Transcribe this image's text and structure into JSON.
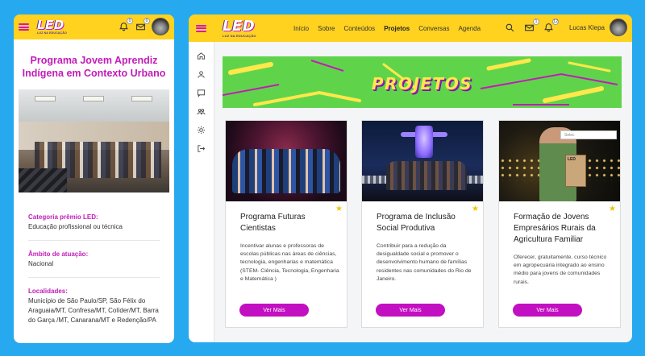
{
  "brand": {
    "logo": "LED",
    "logo_sub": "LUZ NA EDUCAÇÃO"
  },
  "mobile": {
    "badges": {
      "notifications": "0",
      "messages": "0"
    },
    "title": "Programa Jovem Aprendiz Indígena em Contexto Urbano",
    "info": [
      {
        "label": "Categoria prêmio LED:",
        "value": "Educação profissional ou técnica"
      },
      {
        "label": "Âmbito de atuação:",
        "value": "Nacional"
      },
      {
        "label": "Localidades:",
        "value": "Município de São Paulo/SP, São Félix do Araguaia/MT, Confresa/MT, Colíder/MT, Barra do Garça /MT, Canarana/MT e Redenção/PA"
      }
    ]
  },
  "desktop": {
    "nav": [
      "Início",
      "Sobre",
      "Conteúdos",
      "Projetos",
      "Conversas",
      "Agenda"
    ],
    "active_nav": "Projetos",
    "badges": {
      "messages": "1",
      "notifications": "12"
    },
    "user_name": "Lucas Klepa",
    "banner_title": "PROJETOS",
    "cards": [
      {
        "title": "Programa Futuras Cientistas",
        "description": "Incentivar alunas e professoras de escolas públicas nas áreas de ciências, tecnologia, engenharias e matemática (STEM- Ciência, Tecnologia, Engenharia e Matemática )",
        "button": "Ver Mais"
      },
      {
        "title": "Programa de Inclusão Social Produtiva",
        "description": "Contribuir para a redução da desigualdade social e promover o desenvolvimento humano de famílias residentes nas comunidades do Rio de Janeiro.",
        "button": "Ver Mais"
      },
      {
        "title": "Formação de Jovens Empresários Rurais da Agricultura Familiar",
        "description": "Oferecer, gratuitamente, curso técnico em agropecuária integrado ao ensino médio para jovens de comunidades rurais.",
        "button": "Ver Mais"
      }
    ],
    "dropdown_text": "Selec",
    "card_box_text": "LED"
  },
  "colors": {
    "accent": "#c30fc2",
    "header": "#ffd21f",
    "background": "#27a9ef",
    "banner": "#5fd44b"
  }
}
